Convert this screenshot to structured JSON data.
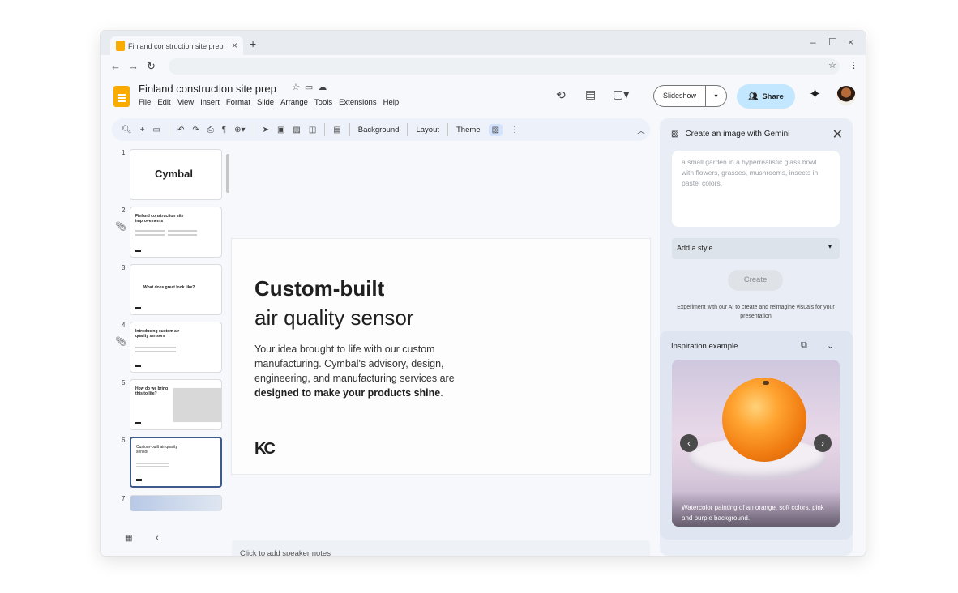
{
  "browser": {
    "tab_title": "Finland construction site prep",
    "new_tab_icon": "+",
    "close_tab_icon": "×"
  },
  "doc": {
    "title": "Finland construction site prep",
    "menu": [
      "File",
      "Edit",
      "View",
      "Insert",
      "Format",
      "Slide",
      "Arrange",
      "Tools",
      "Extensions",
      "Help"
    ]
  },
  "header": {
    "slideshow_label": "Slideshow",
    "share_label": "Share"
  },
  "toolbar": {
    "background_label": "Background",
    "layout_label": "Layout",
    "theme_label": "Theme"
  },
  "filmstrip": {
    "slides": [
      {
        "num": "1",
        "title": "Cymbal"
      },
      {
        "num": "2",
        "title": "Finland construction site improvements"
      },
      {
        "num": "3",
        "title": "What does great look like?"
      },
      {
        "num": "4",
        "title": "Introducing custom air quality sensors"
      },
      {
        "num": "5",
        "title": "How do we bring this to life?"
      },
      {
        "num": "6",
        "title": "Custom-built air quality sensor"
      },
      {
        "num": "7",
        "title": ""
      }
    ]
  },
  "slide": {
    "heading_bold": "Custom-built",
    "heading_light": "air quality sensor",
    "body_1": "Your idea brought to life with our custom manufacturing. Cymbal's advisory, design, engineering, and manufacturing services are",
    "body_bold": "designed to make your products shine",
    "body_end": ".",
    "logo": "KC"
  },
  "notes": {
    "placeholder": "Click to add speaker notes"
  },
  "panel": {
    "title": "Create an image with Gemini",
    "prompt_placeholder": "a small garden in a hyperrealistic glass bowl with flowers, grasses, mushrooms, insects in pastel colors.",
    "style_label": "Add a style",
    "create_label": "Create",
    "experiment_text": "Experiment with our AI to create and reimagine visuals for your presentation",
    "inspiration_title": "Inspiration example",
    "inspiration_caption": "Watercolor painting of an orange, soft colors, pink and purple background."
  },
  "colors": {
    "accent": "#c2e7ff",
    "slides_logo": "#f9ab00",
    "selected_border": "#3c5a8a"
  }
}
